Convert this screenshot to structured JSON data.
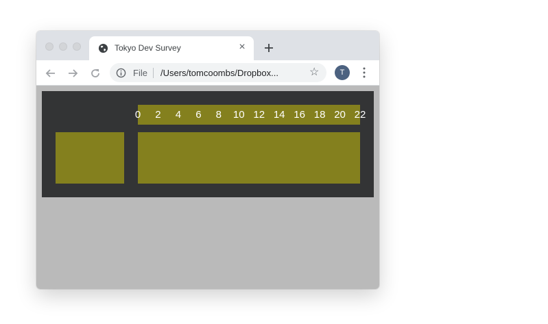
{
  "browser": {
    "tab_title": "Tokyo Dev Survey",
    "tab_close_glyph": "×",
    "address_scheme": "File",
    "address_url": "/Users/tomcoombs/Dropbox...",
    "profile_initial": "T",
    "bookmark_glyph": "☆",
    "icons": [
      "globe-icon",
      "close-icon",
      "new-tab-icon",
      "back-icon",
      "forward-icon",
      "reload-icon",
      "info-icon",
      "star-icon",
      "menu-icon"
    ]
  },
  "chart_data": {
    "type": "bar",
    "xlim": [
      0,
      22
    ],
    "x_ticks": [
      "0",
      "2",
      "4",
      "6",
      "8",
      "10",
      "12",
      "14",
      "16",
      "18",
      "20",
      "22"
    ],
    "bar_color": "#84801e",
    "panel_background": "#333435"
  }
}
